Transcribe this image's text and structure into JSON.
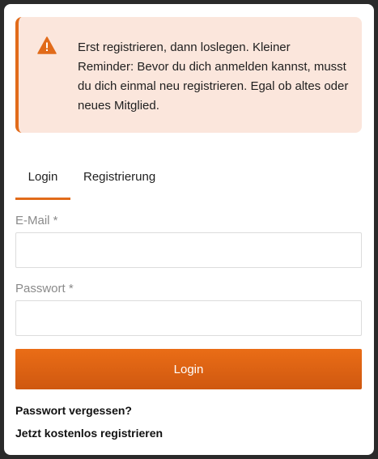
{
  "alert": {
    "icon": "warning-triangle-icon",
    "color": "#e16b1a",
    "background": "#fbe6dc",
    "message": "Erst registrieren, dann loslegen. Kleiner Reminder: Bevor du dich anmelden kannst, musst du dich einmal neu registrieren. Egal ob altes oder neues Mitglied."
  },
  "tabs": {
    "active": "Login",
    "items": [
      {
        "label": "Login"
      },
      {
        "label": "Registrierung"
      }
    ]
  },
  "form": {
    "email": {
      "label": "E-Mail *",
      "value": "",
      "placeholder": ""
    },
    "password": {
      "label": "Passwort *",
      "value": "",
      "placeholder": ""
    },
    "submit_label": "Login",
    "button_color": "#e16b1a"
  },
  "links": {
    "forgot_password": "Passwort vergessen?",
    "register_free": "Jetzt kostenlos registrieren"
  }
}
